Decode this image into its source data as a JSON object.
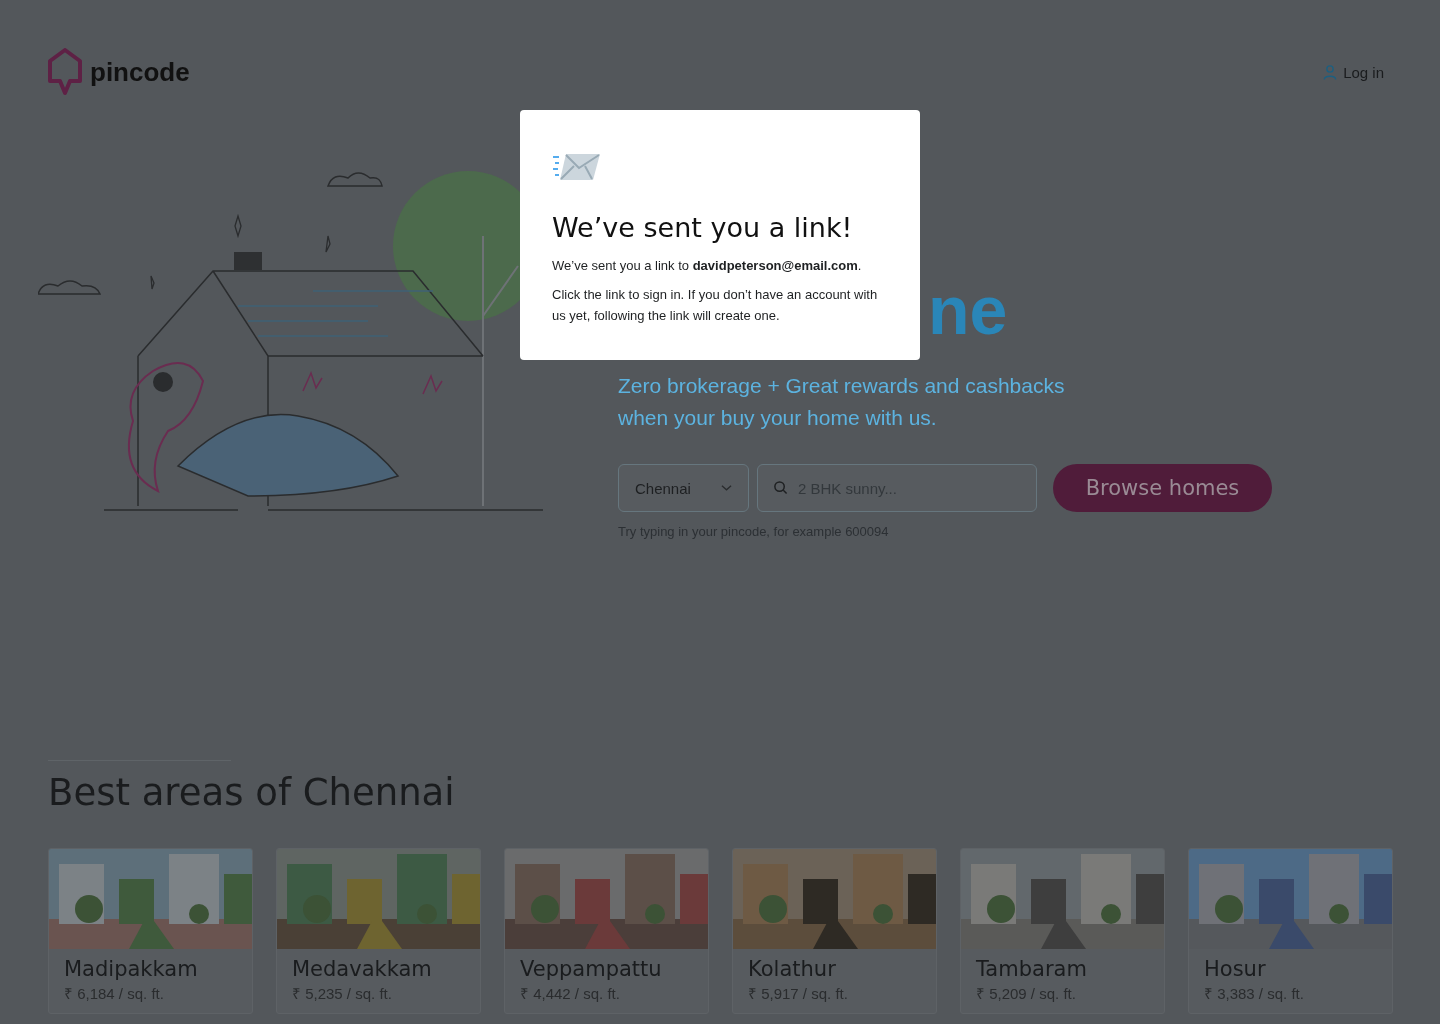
{
  "header": {
    "logo": "pincode",
    "login": "Log in"
  },
  "hero": {
    "heading": "ne",
    "tagline": [
      "Zero brokerage + Great rewards and cashbacks",
      "when your buy your home with us."
    ],
    "city_select": {
      "value": "Chennai"
    },
    "search": {
      "placeholder": "2 BHK sunny..."
    },
    "browse_button": "Browse homes",
    "hint": "Try typing in your pincode, for example 600094"
  },
  "section": {
    "title": "Best areas of Chennai",
    "areas": [
      {
        "name": "Madipakkam",
        "price": "₹ 6,184 / sq. ft.",
        "kind": "picture"
      },
      {
        "name": "Medavakkam",
        "price": "₹ 5,235 / sq. ft.",
        "kind": "picture"
      },
      {
        "name": "Veppampattu",
        "price": "₹ 4,442 / sq. ft.",
        "kind": "picture"
      },
      {
        "name": "Kolathur",
        "price": "₹ 5,917 / sq. ft.",
        "kind": "picture"
      },
      {
        "name": "Tambaram",
        "price": "₹ 5,209 / sq. ft.",
        "kind": "picture"
      },
      {
        "name": "Hosur",
        "price": "₹ 3,383 / sq. ft.",
        "kind": "picture"
      }
    ]
  },
  "modal": {
    "title": "We’ve sent you a link!",
    "message": "We’ve sent you a link to **davidpeterson@email.com**.",
    "note": "Click the link to sign in. If you don’t have an account with us yet, following the link will create one."
  }
}
